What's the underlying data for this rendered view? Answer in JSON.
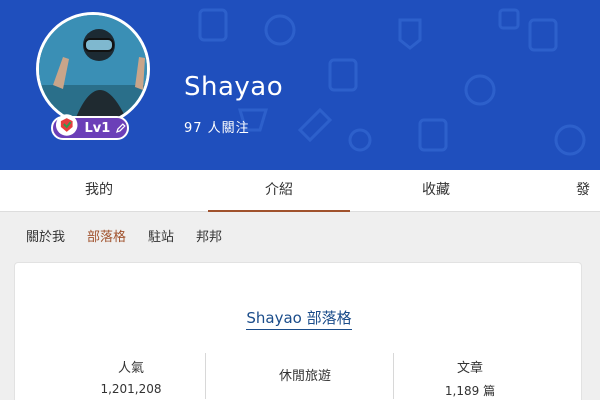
{
  "profile": {
    "name": "Shayao",
    "followers": "97 人關注",
    "level": "Lv1"
  },
  "tabs": {
    "mine": "我的",
    "intro": "介紹",
    "collect": "收藏",
    "publish": "發"
  },
  "subnav": {
    "about": "關於我",
    "blog": "部落格",
    "station": "駐站",
    "help": "邦邦"
  },
  "blog_card": {
    "title": "Shayao 部落格",
    "popularity_label": "人氣",
    "popularity_value": "1,201,208",
    "category": "休閒旅遊",
    "articles_label": "文章",
    "articles_value": "1,189 篇"
  },
  "colors": {
    "banner": "#1f4fbd",
    "badge": "#6b3fb8",
    "accent": "#a0522d",
    "link": "#1a4c8a"
  }
}
